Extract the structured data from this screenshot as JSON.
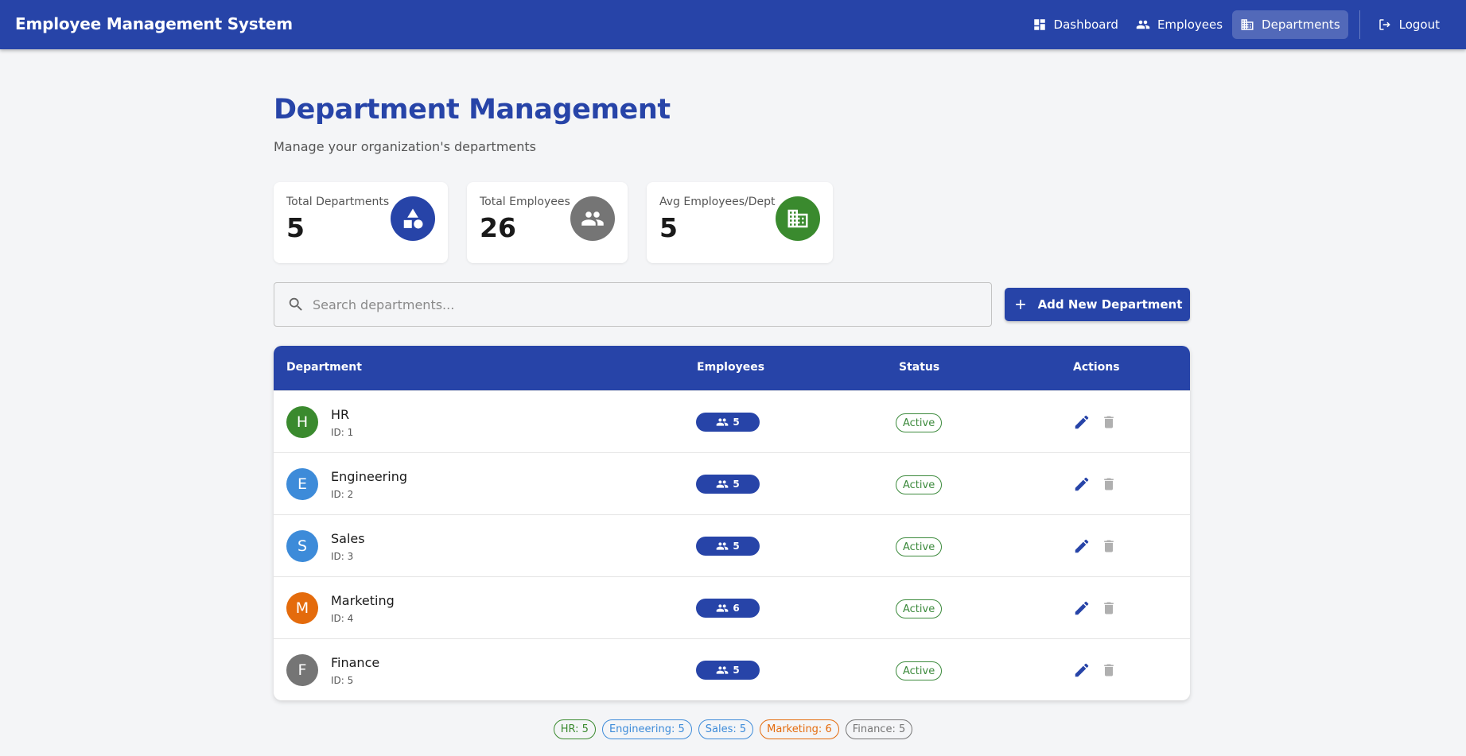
{
  "app": {
    "title": "Employee Management System"
  },
  "nav": {
    "items": [
      {
        "label": "Dashboard",
        "icon": "dashboard-icon"
      },
      {
        "label": "Employees",
        "icon": "people-icon"
      },
      {
        "label": "Departments",
        "icon": "business-icon",
        "active": true
      }
    ],
    "logout_label": "Logout"
  },
  "page": {
    "title": "Department Management",
    "subtitle": "Manage your organization's departments"
  },
  "stats": [
    {
      "label": "Total Departments",
      "value": "5",
      "icon": "category-icon",
      "color": "#2744a8"
    },
    {
      "label": "Total Employees",
      "value": "26",
      "icon": "people-icon",
      "color": "#757575"
    },
    {
      "label": "Avg Employees/Dept",
      "value": "5",
      "icon": "business-icon",
      "color": "#3a8a2e"
    }
  ],
  "search": {
    "placeholder": "Search departments..."
  },
  "add_button": {
    "label": "Add New Department"
  },
  "table": {
    "headers": {
      "department": "Department",
      "employees": "Employees",
      "status": "Status",
      "actions": "Actions"
    },
    "rows": [
      {
        "initial": "H",
        "name": "HR",
        "id": "ID: 1",
        "employees": "5",
        "status": "Active",
        "avatar_color": "#3a8a2e"
      },
      {
        "initial": "E",
        "name": "Engineering",
        "id": "ID: 2",
        "employees": "5",
        "status": "Active",
        "avatar_color": "#3d8bd9"
      },
      {
        "initial": "S",
        "name": "Sales",
        "id": "ID: 3",
        "employees": "5",
        "status": "Active",
        "avatar_color": "#3d8bd9"
      },
      {
        "initial": "M",
        "name": "Marketing",
        "id": "ID: 4",
        "employees": "6",
        "status": "Active",
        "avatar_color": "#e46b0c"
      },
      {
        "initial": "F",
        "name": "Finance",
        "id": "ID: 5",
        "employees": "5",
        "status": "Active",
        "avatar_color": "#757575"
      }
    ]
  },
  "summary_chips": [
    {
      "label": "HR: 5",
      "color": "#3a8a2e"
    },
    {
      "label": "Engineering: 5",
      "color": "#3d8bd9"
    },
    {
      "label": "Sales: 5",
      "color": "#3d8bd9"
    },
    {
      "label": "Marketing: 6",
      "color": "#e46b0c"
    },
    {
      "label": "Finance: 5",
      "color": "#757575"
    }
  ]
}
